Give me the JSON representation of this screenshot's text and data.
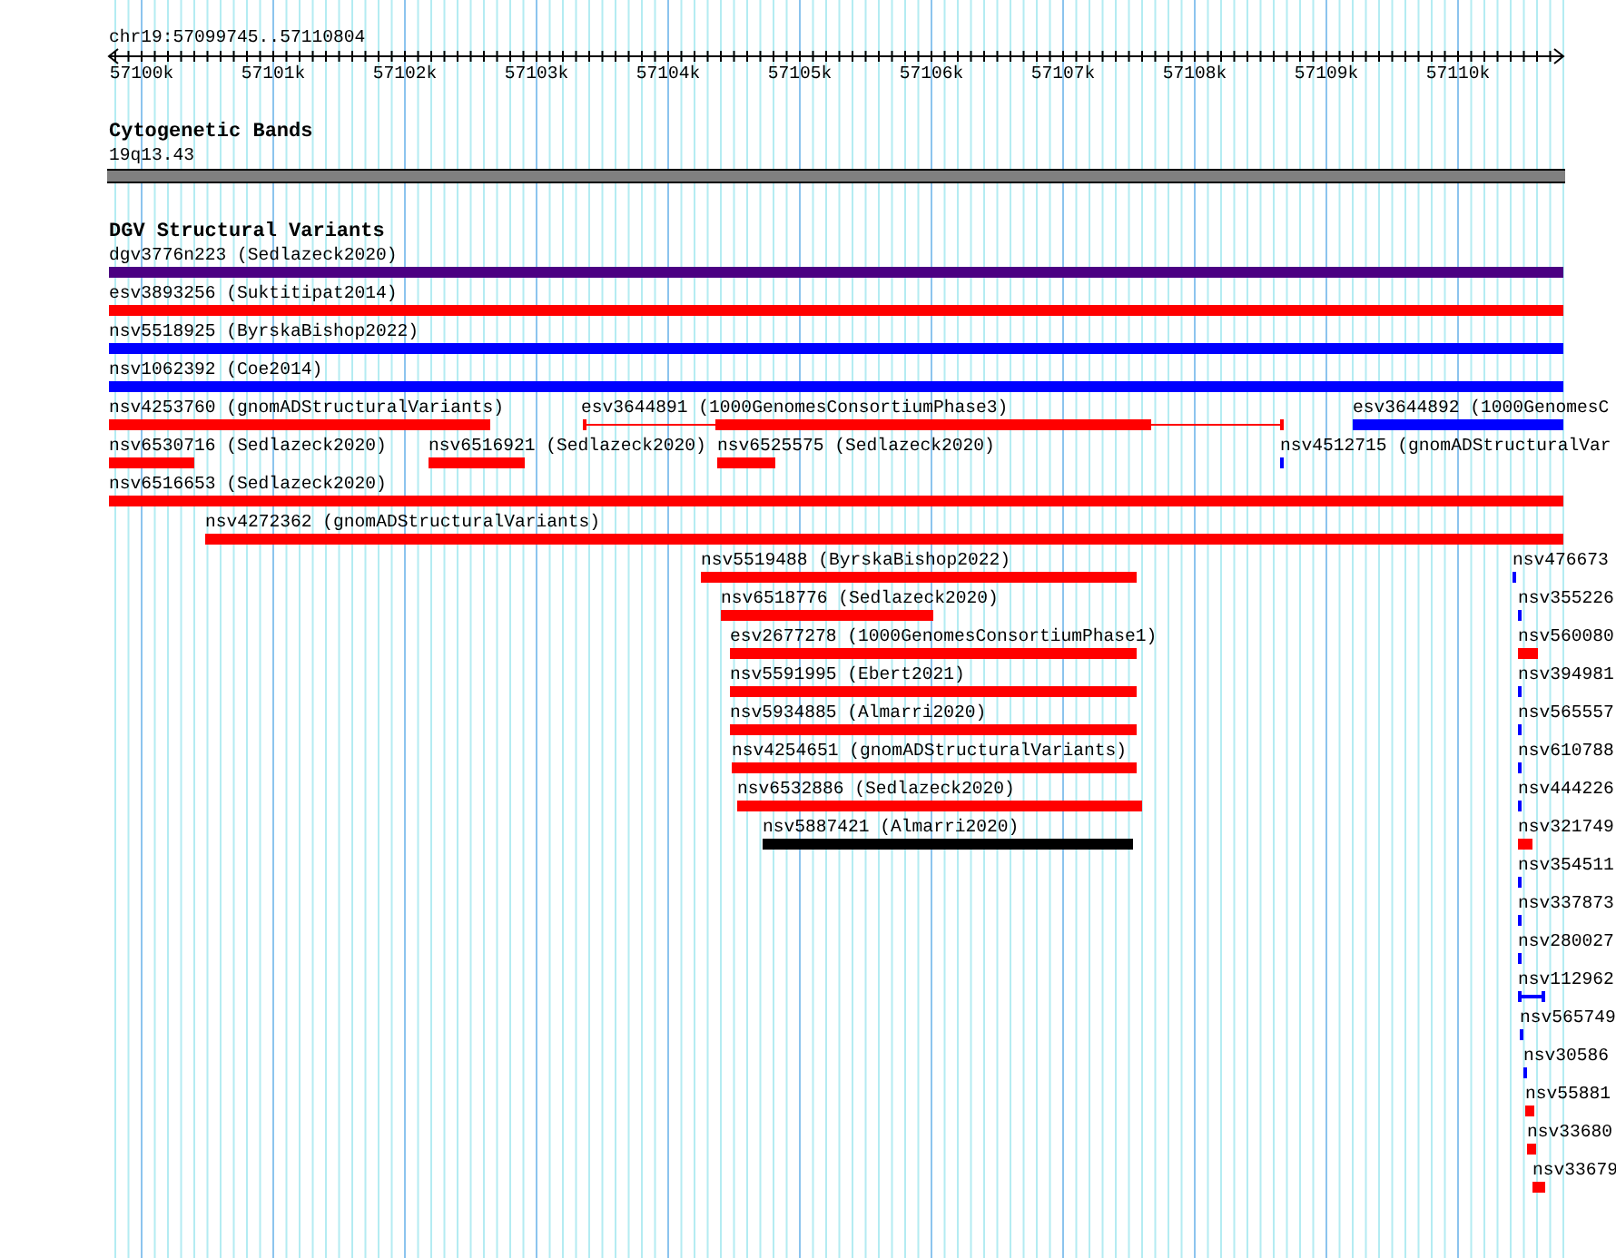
{
  "ruler": {
    "title": "chr19:57099745..57110804",
    "tick_labels": [
      "57100k",
      "57101k",
      "57102k",
      "57103k",
      "57104k",
      "57105k",
      "57106k",
      "57107k",
      "57108k",
      "57109k",
      "57110k"
    ]
  },
  "cytogenetic_bands": {
    "title": "Cytogenetic Bands",
    "band": "19q13.43"
  },
  "dgv_track": {
    "title": "DGV Structural Variants",
    "rows": [
      {
        "features": [
          {
            "label": "dgv3776n223 (Sedlazeck2020)",
            "color": "#4b0082",
            "kind": "bar"
          }
        ]
      },
      {
        "features": [
          {
            "label": "esv3893256 (Suktitipat2014)",
            "color": "#ff0000",
            "kind": "bar"
          }
        ]
      },
      {
        "features": [
          {
            "label": "nsv5518925 (ByrskaBishop2022)",
            "color": "#0000ff",
            "kind": "bar"
          }
        ]
      },
      {
        "features": [
          {
            "label": "nsv1062392 (Coe2014)",
            "color": "#0000ff",
            "kind": "bar"
          }
        ]
      },
      {
        "features": [
          {
            "label": "nsv4253760 (gnomADStructuralVariants)",
            "color": "#ff0000",
            "kind": "bar"
          },
          {
            "label": "esv3644891 (1000GenomesConsortiumPhase3)",
            "color": "#ff0000",
            "kind": "split"
          },
          {
            "label": "esv3644892 (1000GenomesC",
            "color": "#0000ff",
            "kind": "bar"
          }
        ]
      },
      {
        "features": [
          {
            "label": "nsv6530716 (Sedlazeck2020)",
            "color": "#ff0000",
            "kind": "bar"
          },
          {
            "label": "nsv6516921 (Sedlazeck2020)",
            "color": "#ff0000",
            "kind": "bar"
          },
          {
            "label": "nsv6525575 (Sedlazeck2020)",
            "color": "#ff0000",
            "kind": "bar"
          },
          {
            "label": "nsv4512715 (gnomADStructuralVar",
            "color": "#0000ff",
            "kind": "bar"
          }
        ]
      },
      {
        "features": [
          {
            "label": "nsv6516653 (Sedlazeck2020)",
            "color": "#ff0000",
            "kind": "bar"
          }
        ]
      },
      {
        "features": [
          {
            "label": "nsv4272362 (gnomADStructuralVariants)",
            "color": "#ff0000",
            "kind": "bar"
          }
        ]
      },
      {
        "features": [
          {
            "label": "nsv5519488 (ByrskaBishop2022)",
            "color": "#ff0000",
            "kind": "bar"
          },
          {
            "label": "nsv476673",
            "color": "#0000ff",
            "kind": "bar"
          }
        ]
      },
      {
        "features": [
          {
            "label": "nsv6518776 (Sedlazeck2020)",
            "color": "#ff0000",
            "kind": "bar"
          },
          {
            "label": "nsv355226",
            "color": "#0000ff",
            "kind": "bar"
          }
        ]
      },
      {
        "features": [
          {
            "label": "esv2677278 (1000GenomesConsortiumPhase1)",
            "color": "#ff0000",
            "kind": "bar"
          },
          {
            "label": "nsv560080",
            "color": "#ff0000",
            "kind": "bar"
          }
        ]
      },
      {
        "features": [
          {
            "label": "nsv5591995 (Ebert2021)",
            "color": "#ff0000",
            "kind": "bar"
          },
          {
            "label": "nsv394981",
            "color": "#0000ff",
            "kind": "bar"
          }
        ]
      },
      {
        "features": [
          {
            "label": "nsv5934885 (Almarri2020)",
            "color": "#ff0000",
            "kind": "bar"
          },
          {
            "label": "nsv565557",
            "color": "#0000ff",
            "kind": "bar"
          }
        ]
      },
      {
        "features": [
          {
            "label": "nsv4254651 (gnomADStructuralVariants)",
            "color": "#ff0000",
            "kind": "bar"
          },
          {
            "label": "nsv610788",
            "color": "#0000ff",
            "kind": "bar"
          }
        ]
      },
      {
        "features": [
          {
            "label": "nsv6532886 (Sedlazeck2020)",
            "color": "#ff0000",
            "kind": "bar"
          },
          {
            "label": "nsv444226",
            "color": "#0000ff",
            "kind": "bar"
          }
        ]
      },
      {
        "features": [
          {
            "label": "nsv5887421 (Almarri2020)",
            "color": "#000000",
            "kind": "bar"
          },
          {
            "label": "nsv321749",
            "color": "#ff0000",
            "kind": "bar"
          }
        ]
      },
      {
        "features": [
          {
            "label": "nsv354511",
            "color": "#0000ff",
            "kind": "bar"
          }
        ]
      },
      {
        "features": [
          {
            "label": "nsv337873",
            "color": "#0000ff",
            "kind": "bar"
          }
        ]
      },
      {
        "features": [
          {
            "label": "nsv280027",
            "color": "#0000ff",
            "kind": "bar"
          }
        ]
      },
      {
        "features": [
          {
            "label": "nsv112962",
            "color": "#0000ff",
            "kind": "bracket"
          }
        ]
      },
      {
        "features": [
          {
            "label": "nsv565749",
            "color": "#0000ff",
            "kind": "bar"
          }
        ]
      },
      {
        "features": [
          {
            "label": "nsv30586",
            "color": "#0000ff",
            "kind": "bar"
          }
        ]
      },
      {
        "features": [
          {
            "label": "nsv55881",
            "color": "#ff0000",
            "kind": "bar"
          }
        ]
      },
      {
        "features": [
          {
            "label": "nsv33680",
            "color": "#ff0000",
            "kind": "bar"
          }
        ]
      },
      {
        "features": [
          {
            "label": "nsv33679",
            "color": "#ff0000",
            "kind": "bar"
          }
        ]
      }
    ]
  }
}
